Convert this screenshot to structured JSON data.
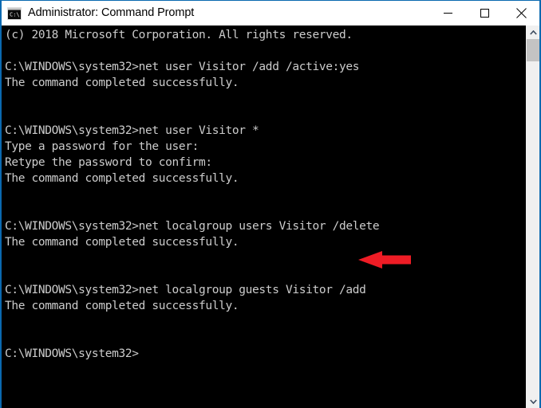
{
  "window": {
    "title": "Administrator: Command Prompt",
    "icon": "command-prompt-icon",
    "accent_color": "#0a69b0",
    "titlebar_background": "#ffffff",
    "titlebar_text_color": "#000000"
  },
  "controls": {
    "minimize_label": "Minimize",
    "maximize_label": "Maximize",
    "close_label": "Close"
  },
  "console": {
    "background": "#000000",
    "foreground": "#cccccc",
    "font_size_px": 14.5,
    "line_height_px": 20,
    "prompt": "C:\\WINDOWS\\system32>",
    "lines": [
      "(c) 2018 Microsoft Corporation. All rights reserved.",
      "",
      "C:\\WINDOWS\\system32>net user Visitor /add /active:yes",
      "The command completed successfully.",
      "",
      "",
      "C:\\WINDOWS\\system32>net user Visitor *",
      "Type a password for the user:",
      "Retype the password to confirm:",
      "The command completed successfully.",
      "",
      "",
      "C:\\WINDOWS\\system32>net localgroup users Visitor /delete",
      "The command completed successfully.",
      "",
      "",
      "C:\\WINDOWS\\system32>net localgroup guests Visitor /add",
      "The command completed successfully.",
      "",
      "",
      "C:\\WINDOWS\\system32>"
    ],
    "text": "(c) 2018 Microsoft Corporation. All rights reserved.\n\nC:\\WINDOWS\\system32>net user Visitor /add /active:yes\nThe command completed successfully.\n\n\nC:\\WINDOWS\\system32>net user Visitor *\nType a password for the user:\nRetype the password to confirm:\nThe command completed successfully.\n\n\nC:\\WINDOWS\\system32>net localgroup users Visitor /delete\nThe command completed successfully.\n\n\nC:\\WINDOWS\\system32>net localgroup guests Visitor /add\nThe command completed successfully.\n\n\nC:\\WINDOWS\\system32>"
  },
  "annotation": {
    "type": "arrow",
    "direction": "left",
    "color": "#ee1c25",
    "points_at_line": "C:\\WINDOWS\\system32>net localgroup guests Visitor /add"
  },
  "scrollbar": {
    "up_arrow": "chevron-up",
    "down_arrow": "chevron-down",
    "thumb_color": "#c3c3c3",
    "track_color": "#f0f0f0"
  }
}
